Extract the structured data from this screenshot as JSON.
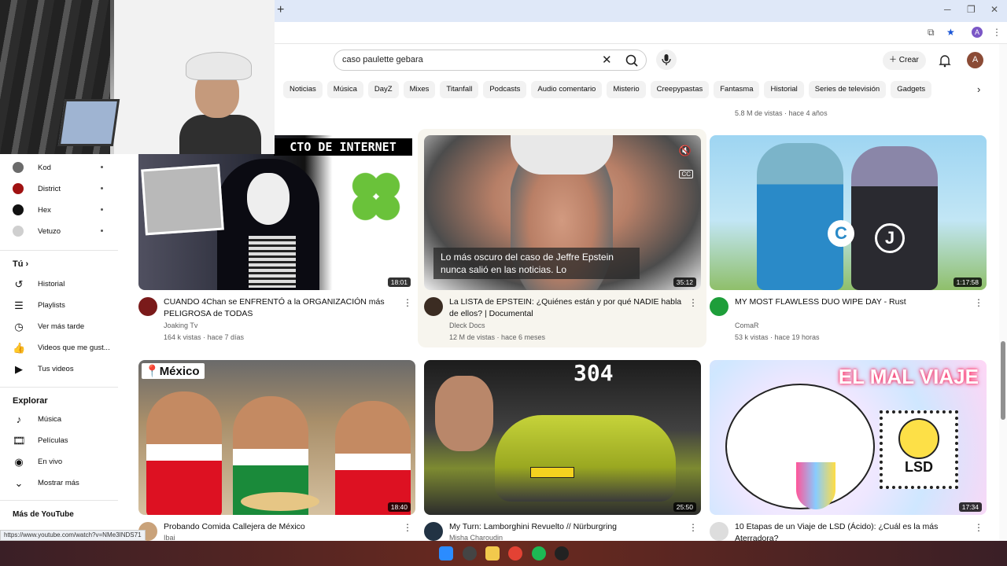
{
  "browser": {
    "new_tab_icon": "plus-icon",
    "window_controls": [
      "minimize-icon",
      "restore-icon",
      "close-icon"
    ],
    "account_initial": "A",
    "status_url": "https://www.youtube.com/watch?v=NMe3INDS71"
  },
  "header": {
    "search_query": "caso paulette gebara",
    "create_label": "Crear",
    "avatar_initial": "A"
  },
  "chips": [
    "Noticias",
    "Música",
    "DayZ",
    "Mixes",
    "Titanfall",
    "Podcasts",
    "Audio comentario",
    "Misterio",
    "Creepypastas",
    "Fantasma",
    "Historial",
    "Series de televisión",
    "Gadgets"
  ],
  "prev_meta": "5.8 M de vistas · hace 4 años",
  "sidebar": {
    "subscriptions": [
      {
        "name": "Kod",
        "color": "#6b6b6b"
      },
      {
        "name": "District",
        "color": "#a01212"
      },
      {
        "name": "Hex",
        "color": "#111111"
      },
      {
        "name": "Vetuzo",
        "color": "#cfcfcf"
      }
    ],
    "you_header": "Tú",
    "you_items": [
      {
        "icon": "history-icon",
        "glyph": "↺",
        "label": "Historial"
      },
      {
        "icon": "playlist-icon",
        "glyph": "☰",
        "label": "Playlists"
      },
      {
        "icon": "watch-later-icon",
        "glyph": "◷",
        "label": "Ver más tarde"
      },
      {
        "icon": "like-icon",
        "glyph": "👍",
        "label": "Videos que me gust..."
      },
      {
        "icon": "your-videos-icon",
        "glyph": "▶",
        "label": "Tus videos"
      }
    ],
    "explore_header": "Explorar",
    "explore_items": [
      {
        "icon": "music-icon",
        "glyph": "♪",
        "label": "Música"
      },
      {
        "icon": "movies-icon",
        "glyph": "🎞",
        "label": "Películas"
      },
      {
        "icon": "live-icon",
        "glyph": "◉",
        "label": "En vivo"
      },
      {
        "icon": "chevron-down-icon",
        "glyph": "⌄",
        "label": "Mostrar más"
      }
    ],
    "more_header": "Más de YouTube"
  },
  "videos": [
    {
      "title": "CUANDO 4Chan se ENFRENTÓ a la ORGANIZACIÓN más PELIGROSA de TODAS",
      "channel": "Joaking Tv",
      "meta": "164 k vistas · hace 7 días",
      "duration": "18:01",
      "thumb_text": "CTO DE INTERNET",
      "avatar_color": "#7a1a1a"
    },
    {
      "title": "La LISTA de EPSTEIN: ¿Quiénes están y por qué NADIE habla de ellos? | Documental",
      "channel": "Dleck Docs",
      "meta": "12 M de vistas · hace 6 meses",
      "duration": "35:12",
      "caption": "Lo más oscuro del caso de Jeffre Epstein nunca salió en las noticias. Lo",
      "avatar_color": "#3b2c22"
    },
    {
      "title": "MY MOST FLAWLESS DUO WIPE DAY - Rust",
      "channel": "ComaR",
      "meta": "53 k vistas · hace 19 horas",
      "duration": "1:17:58",
      "avatar_color": "#1e9e3a"
    },
    {
      "title": "Probando Comida Callejera de México",
      "channel": "Ibai",
      "meta": "",
      "duration": "18:40",
      "thumb_text": "México",
      "avatar_color": "#c9a27a"
    },
    {
      "title": "My Turn: Lamborghini Revuelto // Nürburgring",
      "channel": "Misha Charoudin",
      "meta": "",
      "duration": "25:50",
      "thumb_text": "304",
      "avatar_color": "#234"
    },
    {
      "title": "10 Etapas de un Viaje de LSD (Ácido): ¿Cuál es la más Aterradora?",
      "channel": "",
      "meta": "",
      "duration": "17:34",
      "thumb_text": "EL MAL VIAJE",
      "badge": "LSD",
      "avatar_color": "#ddd"
    }
  ]
}
